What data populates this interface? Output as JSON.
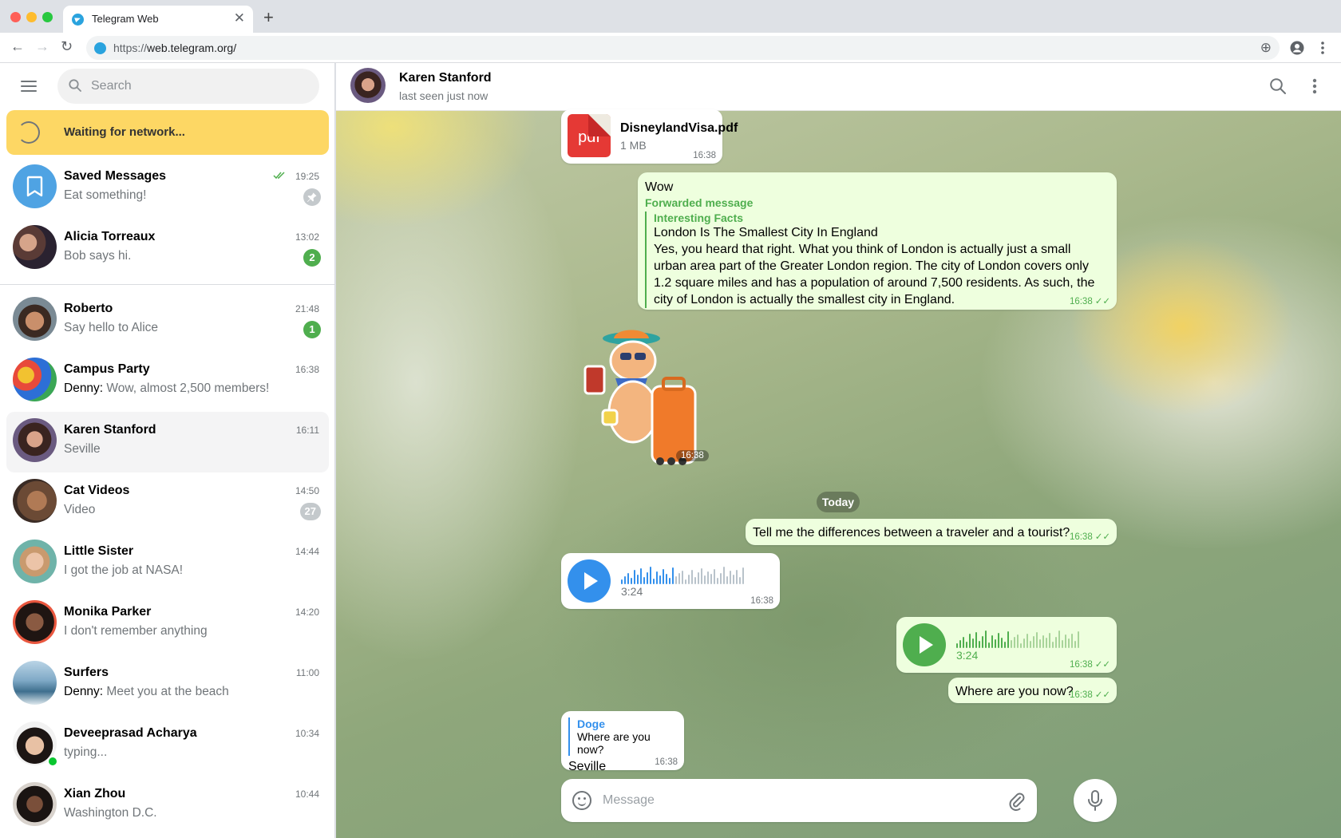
{
  "browser": {
    "tab_title": "Telegram Web",
    "url_scheme": "https://",
    "url_host": "web.telegram.org/"
  },
  "sidebar": {
    "search_placeholder": "Search",
    "network_status": "Waiting for network...",
    "pinned_chats": [
      {
        "name": "Saved Messages",
        "message": "Eat something!",
        "time": "19:25",
        "read": true,
        "pinned": true,
        "avatar": "bookmark-icon"
      },
      {
        "name": "Alicia Torreaux",
        "message": "Bob says hi.",
        "time": "13:02",
        "badge": "2"
      }
    ],
    "chats": [
      {
        "name": "Roberto",
        "message": "Say hello to Alice",
        "time": "21:48",
        "badge": "1"
      },
      {
        "name": "Campus Party",
        "sender": "Denny: ",
        "message": "Wow, almost 2,500 members!",
        "time": "16:38"
      },
      {
        "name": "Karen Stanford",
        "message": "Seville",
        "time": "16:11",
        "active": true
      },
      {
        "name": "Cat Videos",
        "message": "Video",
        "time": "14:50",
        "badge": "27",
        "muted": true
      },
      {
        "name": "Little Sister",
        "message": "I got the job at NASA!",
        "time": "14:44"
      },
      {
        "name": "Monika Parker",
        "message": "I don't remember anything",
        "time": "14:20"
      },
      {
        "name": "Surfers",
        "sender": "Denny: ",
        "message": "Meet you at the beach",
        "time": "11:00"
      },
      {
        "name": "Deveeprasad Acharya",
        "message": "typing...",
        "time": "10:34",
        "online": true
      },
      {
        "name": "Xian Zhou",
        "message": "Washington D.C.",
        "time": "10:44"
      }
    ]
  },
  "chat": {
    "name": "Karen Stanford",
    "status": "last seen just now",
    "date_separator": "Today",
    "file": {
      "icon_label": "pdf",
      "name": "DisneylandVisa.pdf",
      "size": "1 MB",
      "time": "16:38"
    },
    "forwarded": {
      "text": "Wow",
      "label": "Forwarded message",
      "source": "Interesting Facts",
      "title": "London Is The Smallest City In England",
      "body": "Yes, you heard that right. What you think of London is actually just a small urban area part of the Greater London region. The city of London covers only 1.2 square miles and has a population of around 7,500 residents. As such, the city of London is actually the smallest city in England.",
      "time": "16:38"
    },
    "sticker_time": "16:38",
    "msg_question": {
      "text": "Tell me the differences between a traveler and a tourist?",
      "time": "16:38"
    },
    "voice_in": {
      "duration": "3:24",
      "time": "16:38"
    },
    "voice_out": {
      "duration": "3:24",
      "time": "16:38"
    },
    "msg_where": {
      "text": "Where are you now?",
      "time": "16:38"
    },
    "reply": {
      "reply_name": "Doge",
      "reply_text": "Where are you now?",
      "text": "Seville",
      "time": "16:38"
    },
    "composer_placeholder": "Message"
  },
  "colors": {
    "accent": "#3390ec",
    "outgoing_bubble": "#eeffde",
    "green": "#4fae4e",
    "banner": "#fdd764"
  }
}
